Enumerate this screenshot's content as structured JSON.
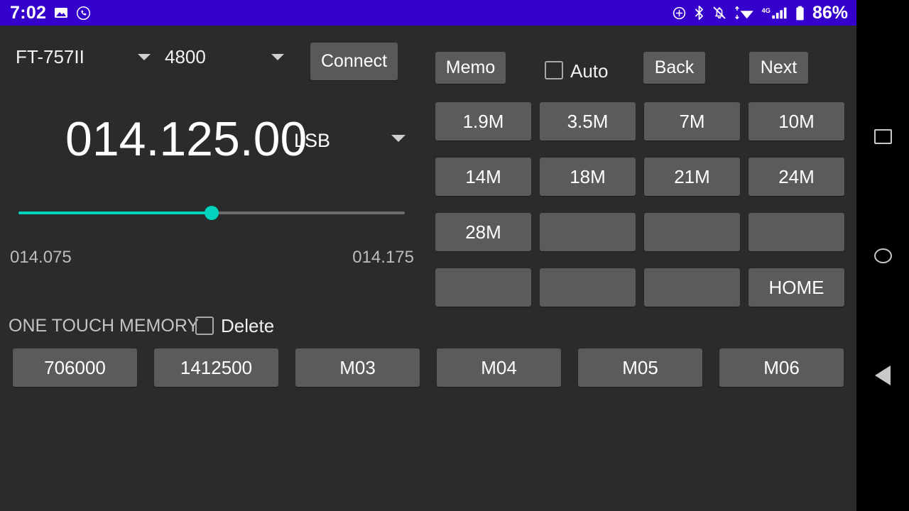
{
  "statusbar": {
    "clock": "7:02",
    "battery_percent": "86%",
    "bg_color": "#3500CC",
    "left_icons": [
      "image-icon",
      "phone-call-icon"
    ],
    "right_icons": [
      "location-add-icon",
      "bluetooth-icon",
      "notifications-off-icon",
      "wifi-icon",
      "signal-4g-icon",
      "battery-icon"
    ],
    "network_label": "4G"
  },
  "toolbar": {
    "radio_model": "FT-757II",
    "baud_rate": "4800",
    "connect_label": "Connect"
  },
  "vfo": {
    "frequency": "014.125.00",
    "mode": "LSB"
  },
  "slider": {
    "min_label": "014.075",
    "max_label": "014.175",
    "value_percent": 50,
    "accent_color": "#00D2BE",
    "track_color": "#6D6D6D"
  },
  "memory_panel": {
    "section_label": "ONE TOUCH MEMORY",
    "delete_label": "Delete",
    "delete_checked": false,
    "buttons": [
      "706000",
      "1412500",
      "M03",
      "M04",
      "M05",
      "M06"
    ]
  },
  "right_panel": {
    "memo_label": "Memo",
    "auto_label": "Auto",
    "auto_checked": false,
    "back_label": "Back",
    "next_label": "Next",
    "bands": [
      "1.9M",
      "3.5M",
      "7M",
      "10M",
      "14M",
      "18M",
      "21M",
      "24M",
      "28M",
      "",
      "",
      "",
      "",
      "",
      "",
      "HOME"
    ]
  },
  "navbar": {
    "recents_label": "recents",
    "home_label": "home",
    "back_label": "back"
  },
  "theme": {
    "app_background": "#2B2B2B",
    "button_background": "#5B5B5B",
    "text_primary": "#FFFFFF",
    "text_secondary": "#C4C4C4"
  }
}
